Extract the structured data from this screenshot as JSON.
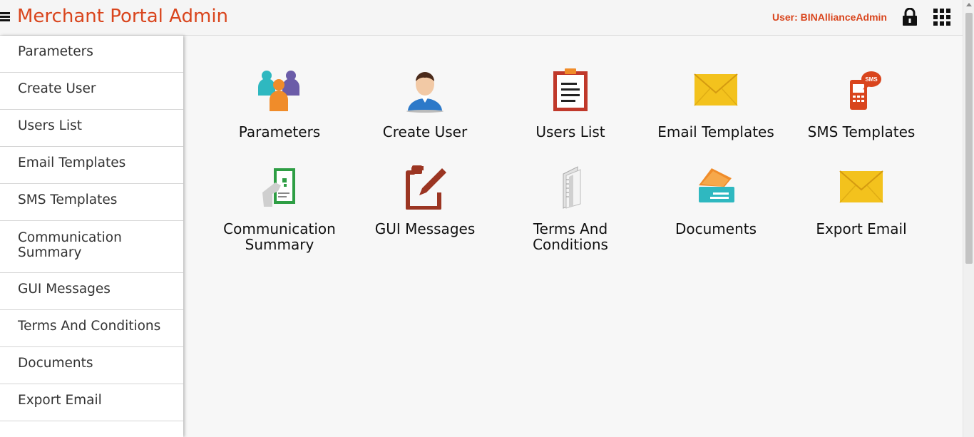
{
  "header": {
    "title": "Merchant Portal Admin",
    "user_label": "User: BINAllianceAdmin",
    "menu_icon": "hamburger-icon",
    "lock_icon": "lock-icon",
    "apps_icon": "app-grid-icon"
  },
  "sidebar": {
    "items": [
      {
        "label": "Parameters"
      },
      {
        "label": "Create User"
      },
      {
        "label": "Users List"
      },
      {
        "label": "Email Templates"
      },
      {
        "label": "SMS Templates"
      },
      {
        "label": "Communication Summary"
      },
      {
        "label": "GUI Messages"
      },
      {
        "label": "Terms And Conditions"
      },
      {
        "label": "Documents"
      },
      {
        "label": "Export Email"
      }
    ]
  },
  "tiles": [
    {
      "label": "Parameters",
      "icon": "people-group-icon"
    },
    {
      "label": "Create User",
      "icon": "user-avatar-icon"
    },
    {
      "label": "Users List",
      "icon": "clipboard-list-icon"
    },
    {
      "label": "Email Templates",
      "icon": "envelope-icon"
    },
    {
      "label": "SMS Templates",
      "icon": "sms-phone-icon"
    },
    {
      "label": "Communication Summary",
      "icon": "document-hand-icon"
    },
    {
      "label": "GUI Messages",
      "icon": "pen-edit-icon"
    },
    {
      "label": "Terms And Conditions",
      "icon": "documents-stack-icon"
    },
    {
      "label": "Documents",
      "icon": "ticket-folder-icon"
    },
    {
      "label": "Export Email",
      "icon": "envelope-icon"
    }
  ],
  "sms_badge": "SMS",
  "colors": {
    "brand": "#d9451d",
    "sidebar_bg": "#ffffff",
    "content_bg": "#f7f7f7"
  }
}
